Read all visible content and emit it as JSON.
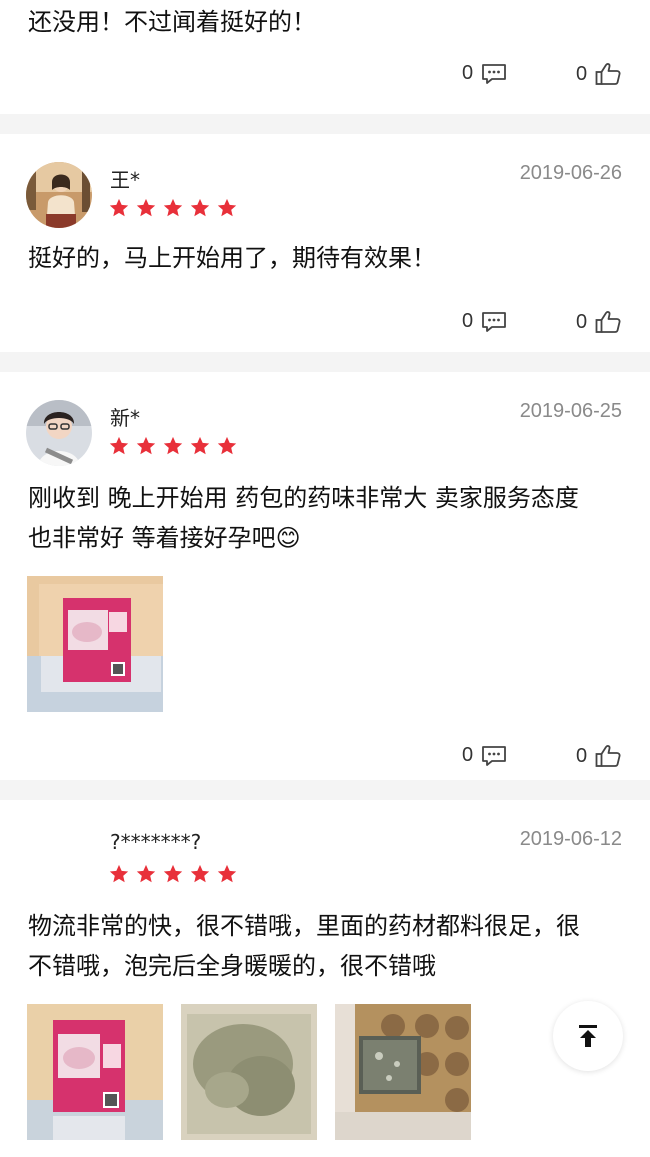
{
  "top_review": {
    "text": "还没用！不过闻着挺好的！",
    "comment_count": "0",
    "like_count": "0"
  },
  "reviews": [
    {
      "username": "王*",
      "date": "2019-06-26",
      "rating": 5,
      "text": "挺好的，马上开始用了，期待有效果！",
      "comment_count": "0",
      "like_count": "0"
    },
    {
      "username": "新*",
      "date": "2019-06-25",
      "rating": 5,
      "text_line1": "刚收到 晚上开始用 药包的药味非常大 卖家服务态度",
      "text_line2": "也非常好 等着接好孕吧😊",
      "comment_count": "0",
      "like_count": "0"
    },
    {
      "username": "?*******?",
      "date": "2019-06-12",
      "rating": 5,
      "text_line1": "物流非常的快，很不错哦，里面的药材都料很足，很",
      "text_line2": "不错哦，泡完后全身暖暖的，很不错哦"
    }
  ],
  "icons": {
    "comment": "comment-bubble-icon",
    "like": "thumbs-up-icon",
    "star": "star-icon",
    "back_to_top": "back-to-top-icon"
  },
  "colors": {
    "star": "#e8303a",
    "divider": "#f4f4f4",
    "date": "#8a8a8a",
    "pack_label": "#d6326d"
  }
}
